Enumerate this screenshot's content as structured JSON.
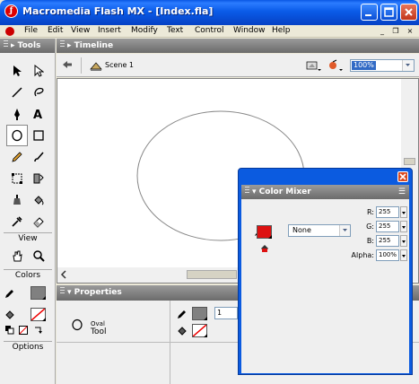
{
  "window": {
    "title": "Macromedia Flash MX - [Index.fla]"
  },
  "menu": [
    "File",
    "Edit",
    "View",
    "Insert",
    "Modify",
    "Text",
    "Control",
    "Window",
    "Help"
  ],
  "tools": {
    "title": "Tools",
    "view_label": "View",
    "colors_label": "Colors",
    "options_label": "Options"
  },
  "timeline": {
    "title": "Timeline"
  },
  "editbar": {
    "scene": "Scene 1",
    "zoom": "100%"
  },
  "properties": {
    "title": "Properties",
    "tool_name": "Oval",
    "tool_sub": "Tool",
    "stroke_width": "1"
  },
  "mixer": {
    "title": "Color Mixer",
    "fill_style": "None",
    "r_label": "R:",
    "r_value": "255",
    "g_label": "G:",
    "g_value": "255",
    "b_label": "B:",
    "b_value": "255",
    "alpha_label": "Alpha:",
    "alpha_value": "100%"
  },
  "colors": {
    "fill": "#dd1111",
    "stroke": "#808080",
    "title_bar": "#0a57e4"
  }
}
